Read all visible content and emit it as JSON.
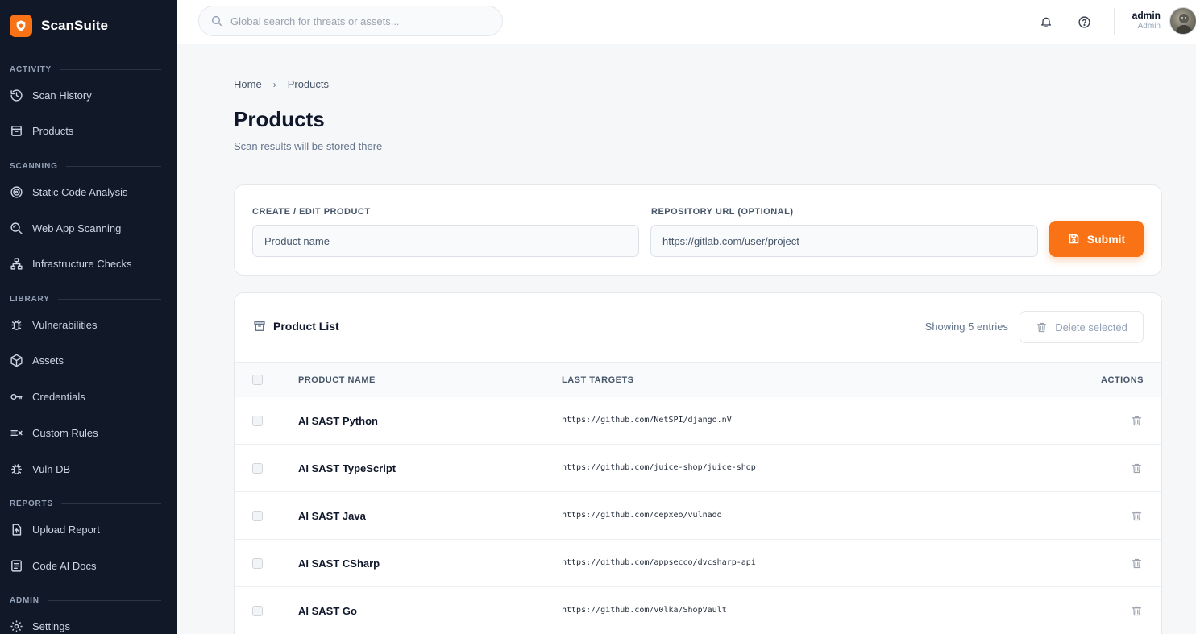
{
  "app": {
    "name": "ScanSuite"
  },
  "colors": {
    "accent": "#f97316",
    "sidebar_bg": "#111827"
  },
  "sidebar": {
    "sections": [
      {
        "label": "ACTIVITY"
      },
      {
        "label": "SCANNING"
      },
      {
        "label": "LIBRARY"
      },
      {
        "label": "REPORTS"
      },
      {
        "label": "ADMIN"
      }
    ],
    "items": [
      {
        "label": "Scan History",
        "icon": "history-icon"
      },
      {
        "label": "Products",
        "icon": "archive-icon"
      },
      {
        "label": "Static Code Analysis",
        "icon": "target-icon"
      },
      {
        "label": "Web App Scanning",
        "icon": "search-scan-icon"
      },
      {
        "label": "Infrastructure Checks",
        "icon": "network-icon"
      },
      {
        "label": "Vulnerabilities",
        "icon": "bug-icon"
      },
      {
        "label": "Assets",
        "icon": "box-icon"
      },
      {
        "label": "Credentials",
        "icon": "key-icon"
      },
      {
        "label": "Custom Rules",
        "icon": "rules-icon"
      },
      {
        "label": "Vuln DB",
        "icon": "bug-icon"
      },
      {
        "label": "Upload Report",
        "icon": "upload-icon"
      },
      {
        "label": "Code AI Docs",
        "icon": "document-icon"
      },
      {
        "label": "Settings",
        "icon": "gear-icon"
      }
    ]
  },
  "topbar": {
    "search_placeholder": "Global search for threats or assets...",
    "user": {
      "name": "admin",
      "role": "Admin"
    }
  },
  "breadcrumb": {
    "home": "Home",
    "current": "Products"
  },
  "page": {
    "title": "Products",
    "subtitle": "Scan results will be stored there"
  },
  "form": {
    "product_label": "CREATE / EDIT PRODUCT",
    "product_placeholder": "Product name",
    "product_value": "",
    "repo_label": "REPOSITORY URL (OPTIONAL)",
    "repo_placeholder": "https://gitlab.com/user/project",
    "repo_value": "",
    "submit_label": "Submit"
  },
  "list": {
    "title": "Product List",
    "entries_text": "Showing 5 entries",
    "delete_label": "Delete selected",
    "columns": {
      "name": "PRODUCT NAME",
      "targets": "LAST TARGETS",
      "actions": "ACTIONS"
    },
    "rows": [
      {
        "name": "AI SAST Python",
        "target": "https://github.com/NetSPI/django.nV"
      },
      {
        "name": "AI SAST TypeScript",
        "target": "https://github.com/juice-shop/juice-shop"
      },
      {
        "name": "AI SAST Java",
        "target": "https://github.com/cepxeo/vulnado"
      },
      {
        "name": "AI SAST CSharp",
        "target": "https://github.com/appsecco/dvcsharp-api"
      },
      {
        "name": "AI SAST Go",
        "target": "https://github.com/v0lka/ShopVault"
      }
    ]
  }
}
